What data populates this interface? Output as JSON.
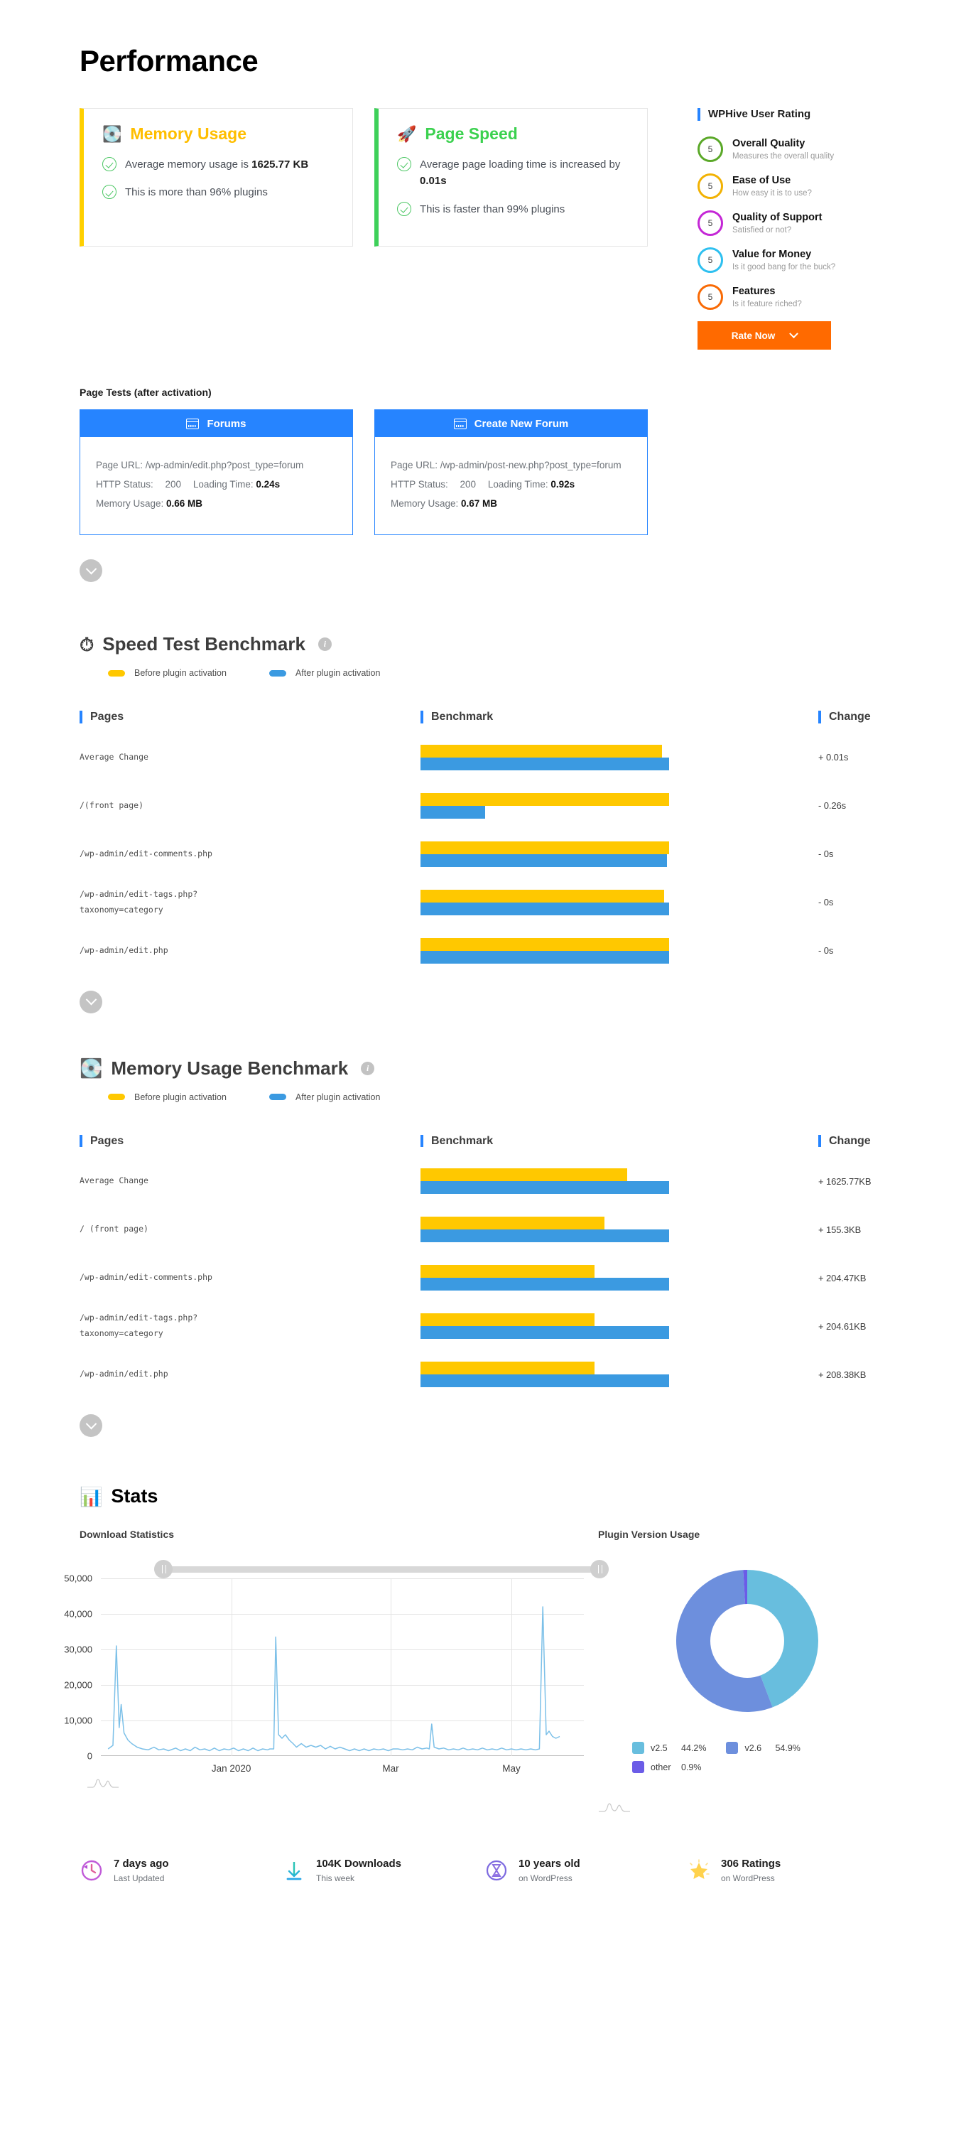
{
  "page": {
    "title": "Performance"
  },
  "summary": {
    "memory": {
      "icon": "memory-chip-icon",
      "title": "Memory Usage",
      "line1_pre": "Average memory usage is ",
      "line1_value": "1625.77 KB",
      "line2": "This is more than 96% plugins",
      "accent": "#ffd000"
    },
    "speed": {
      "icon": "rocket-icon",
      "title": "Page Speed",
      "line1_pre": "Average page loading time is increased by ",
      "line1_value": "0.01s",
      "line2": "This is faster than 99% plugins",
      "accent": "#3ed05a"
    }
  },
  "rating": {
    "title": "WPHive User Rating",
    "items": [
      {
        "score": "5",
        "name": "Overall Quality",
        "sub": "Measures the overall quality",
        "color": "#5aa828"
      },
      {
        "score": "5",
        "name": "Ease of Use",
        "sub": "How easy it is to use?",
        "color": "#f2b203"
      },
      {
        "score": "5",
        "name": "Quality of Support",
        "sub": "Satisfied or not?",
        "color": "#c427d6"
      },
      {
        "score": "5",
        "name": "Value for Money",
        "sub": "Is it good bang for the buck?",
        "color": "#2ec0f0"
      },
      {
        "score": "5",
        "name": "Features",
        "sub": "Is it feature riched?",
        "color": "#f96a05"
      }
    ],
    "rate_button": "Rate Now"
  },
  "page_tests": {
    "label": "Page Tests (after activation)",
    "cards": [
      {
        "title": "Forums",
        "url_label": "Page URL: ",
        "url": "/wp-admin/edit.php?post_type=forum",
        "status_label": "HTTP Status: ",
        "status": "200",
        "loading_label": "Loading Time: ",
        "loading": "0.24s",
        "memory_label": "Memory Usage: ",
        "memory": "0.66 MB"
      },
      {
        "title": "Create New Forum",
        "url_label": "Page URL: ",
        "url": "/wp-admin/post-new.php?post_type=forum",
        "status_label": "HTTP Status: ",
        "status": "200",
        "loading_label": "Loading Time: ",
        "loading": "0.92s",
        "memory_label": "Memory Usage: ",
        "memory": "0.67 MB"
      }
    ]
  },
  "speed_bench": {
    "icon": "speedometer-icon",
    "title": "Speed Test Benchmark",
    "info": "i",
    "legend": [
      {
        "label": "Before plugin activation",
        "color": "#ffc800"
      },
      {
        "label": "After plugin activation",
        "color": "#3b9ae1"
      }
    ],
    "columns": {
      "pages": "Pages",
      "benchmark": "Benchmark",
      "change": "Change"
    }
  },
  "memory_bench": {
    "icon": "memory-chip-icon",
    "title": "Memory Usage Benchmark",
    "info": "i",
    "legend": [
      {
        "label": "Before plugin activation",
        "color": "#ffc800"
      },
      {
        "label": "After plugin activation",
        "color": "#3b9ae1"
      }
    ],
    "columns": {
      "pages": "Pages",
      "benchmark": "Benchmark",
      "change": "Change"
    }
  },
  "stats": {
    "icon": "bar-chart-icon",
    "title": "Stats",
    "downloads_title": "Download Statistics",
    "versions_title": "Plugin Version Usage"
  },
  "footer": {
    "items": [
      {
        "icon": "clock-rewind-icon",
        "big": "7 days ago",
        "small": "Last Updated"
      },
      {
        "icon": "download-icon",
        "big": "104K Downloads",
        "small": "This week"
      },
      {
        "icon": "hourglass-icon",
        "big": "10 years old",
        "small": "on WordPress"
      },
      {
        "icon": "star-icon",
        "big": "306 Ratings",
        "small": "on WordPress"
      }
    ]
  },
  "chart_data": [
    {
      "type": "bar",
      "name": "speed-test-benchmark",
      "title": "Speed Test Benchmark",
      "orientation": "horizontal",
      "unit": "s",
      "categories": [
        "Average Change",
        "/(front page)",
        "/wp-admin/edit-comments.php",
        "/wp-admin/edit-tags.php?\ntaxonomy=category",
        "/wp-admin/edit.php"
      ],
      "series": [
        {
          "name": "Before plugin activation",
          "color": "#ffc800",
          "values_pct": [
            97,
            100,
            100,
            98,
            100
          ]
        },
        {
          "name": "After plugin activation",
          "color": "#3b9ae1",
          "values_pct": [
            100,
            26,
            99,
            100,
            100
          ]
        }
      ],
      "change": [
        "+ 0.01s",
        "- 0.26s",
        "- 0s",
        "- 0s",
        "- 0s"
      ],
      "legend_position": "top"
    },
    {
      "type": "bar",
      "name": "memory-usage-benchmark",
      "title": "Memory Usage Benchmark",
      "orientation": "horizontal",
      "unit": "KB",
      "categories": [
        "Average Change",
        "/ (front page)",
        "/wp-admin/edit-comments.php",
        "/wp-admin/edit-tags.php?\ntaxonomy=category",
        "/wp-admin/edit.php"
      ],
      "series": [
        {
          "name": "Before plugin activation",
          "color": "#ffc800",
          "values_pct": [
            83,
            74,
            70,
            70,
            70
          ]
        },
        {
          "name": "After plugin activation",
          "color": "#3b9ae1",
          "values_pct": [
            100,
            100,
            100,
            100,
            100
          ]
        }
      ],
      "change": [
        "+ 1625.77KB",
        "+ 155.3KB",
        "+ 204.47KB",
        "+ 204.61KB",
        "+ 208.38KB"
      ],
      "legend_position": "top"
    },
    {
      "type": "line",
      "name": "download-statistics",
      "title": "Download Statistics",
      "ylim": [
        0,
        50000
      ],
      "yticks": [
        0,
        10000,
        20000,
        30000,
        40000,
        50000
      ],
      "yticklabels": [
        "0",
        "10,000",
        "20,000",
        "30,000",
        "40,000",
        "50,000"
      ],
      "xticklabels": [
        "Jan 2020",
        "Mar",
        "May"
      ],
      "xtick_pct": [
        27,
        60,
        85
      ],
      "grid": true,
      "line_color": "#7cc0e8",
      "series": [
        {
          "name": "Downloads",
          "points_pct": [
            [
              1.5,
              4
            ],
            [
              2.5,
              6
            ],
            [
              3.2,
              62
            ],
            [
              3.8,
              16
            ],
            [
              4.2,
              29
            ],
            [
              4.8,
              13
            ],
            [
              5.6,
              9
            ],
            [
              6.4,
              7
            ],
            [
              7.5,
              5
            ],
            [
              8.6,
              4
            ],
            [
              9.8,
              3.5
            ],
            [
              11,
              5
            ],
            [
              12,
              3.5
            ],
            [
              13,
              4
            ],
            [
              14,
              3
            ],
            [
              15.5,
              4.5
            ],
            [
              16.5,
              3
            ],
            [
              17.5,
              4
            ],
            [
              18.5,
              3
            ],
            [
              19.5,
              5
            ],
            [
              20.5,
              3.5
            ],
            [
              21.5,
              4
            ],
            [
              22.5,
              3
            ],
            [
              23.5,
              4.5
            ],
            [
              24.5,
              3
            ],
            [
              25.5,
              4
            ],
            [
              26.5,
              3.5
            ],
            [
              27.5,
              4.5
            ],
            [
              28.5,
              3
            ],
            [
              29.5,
              4
            ],
            [
              30.5,
              3
            ],
            [
              31.5,
              4.5
            ],
            [
              32.5,
              3
            ],
            [
              33.5,
              4
            ],
            [
              34.5,
              3.5
            ],
            [
              35,
              4
            ],
            [
              35.8,
              4
            ],
            [
              36.2,
              67
            ],
            [
              36.8,
              12
            ],
            [
              37.5,
              10
            ],
            [
              38.2,
              12
            ],
            [
              39,
              9
            ],
            [
              39.8,
              7
            ],
            [
              40.5,
              5
            ],
            [
              41.5,
              7
            ],
            [
              42.5,
              5
            ],
            [
              43.5,
              6
            ],
            [
              44.5,
              5
            ],
            [
              45.5,
              6
            ],
            [
              46.5,
              4
            ],
            [
              47.5,
              5.5
            ],
            [
              48.5,
              4
            ],
            [
              49.5,
              5
            ],
            [
              50.5,
              4
            ],
            [
              51.5,
              3
            ],
            [
              52.5,
              4
            ],
            [
              53.5,
              3
            ],
            [
              54.5,
              4
            ],
            [
              55.5,
              3
            ],
            [
              56.5,
              4
            ],
            [
              57.5,
              3.5
            ],
            [
              58.5,
              4
            ],
            [
              59.5,
              3
            ],
            [
              60.5,
              4
            ],
            [
              61.5,
              4
            ],
            [
              62.5,
              3.5
            ],
            [
              63.5,
              4
            ],
            [
              64.5,
              3.5
            ],
            [
              65.5,
              5
            ],
            [
              66.5,
              4
            ],
            [
              67.5,
              4.5
            ],
            [
              68,
              4
            ],
            [
              68.5,
              18
            ],
            [
              69,
              5
            ],
            [
              70,
              4
            ],
            [
              71,
              4.5
            ],
            [
              72,
              3.5
            ],
            [
              73,
              4
            ],
            [
              74,
              3.5
            ],
            [
              75,
              4.5
            ],
            [
              76,
              3.5
            ],
            [
              77,
              4
            ],
            [
              78,
              3.5
            ],
            [
              79,
              4.5
            ],
            [
              80,
              3.5
            ],
            [
              81,
              4
            ],
            [
              82,
              3.5
            ],
            [
              83,
              4.5
            ],
            [
              84,
              3.5
            ],
            [
              85,
              4
            ],
            [
              86,
              3.5
            ],
            [
              87,
              4
            ],
            [
              88,
              3.5
            ],
            [
              89,
              4
            ],
            [
              90,
              3.5
            ],
            [
              90.8,
              4
            ],
            [
              91.5,
              84
            ],
            [
              92.2,
              12
            ],
            [
              92.8,
              14
            ],
            [
              93.5,
              11
            ],
            [
              94.2,
              10
            ],
            [
              95,
              11
            ]
          ]
        }
      ]
    },
    {
      "type": "pie",
      "name": "plugin-version-usage",
      "title": "Plugin Version Usage",
      "donut": true,
      "labels": [
        "v2.5",
        "v2.6",
        "other"
      ],
      "values": [
        44.2,
        54.9,
        0.9
      ],
      "value_labels": [
        "44.2%",
        "54.9%",
        "0.9%"
      ],
      "colors": [
        "#68bede",
        "#6d8fdd",
        "#6b5ce7"
      ],
      "legend_position": "bottom"
    }
  ]
}
